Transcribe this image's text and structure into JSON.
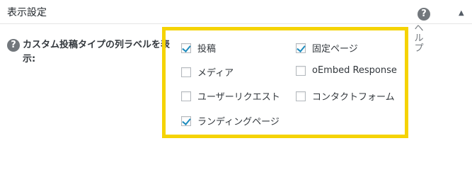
{
  "panel": {
    "title": "表示設定",
    "collapse_arrow": "▲",
    "help_tab_label": "ヘルプ",
    "help_glyph": "?"
  },
  "setting": {
    "label": "カスタム投稿タイプの列ラベルを表示:",
    "help_glyph": "?"
  },
  "options": [
    {
      "label": "投稿",
      "checked": true
    },
    {
      "label": "固定ページ",
      "checked": true
    },
    {
      "label": "メディア",
      "checked": false
    },
    {
      "label": "oEmbed Response",
      "checked": false
    },
    {
      "label": "ユーザーリクエスト",
      "checked": false
    },
    {
      "label": "コンタクトフォーム",
      "checked": false
    },
    {
      "label": "ランディングページ",
      "checked": true
    }
  ],
  "colors": {
    "highlight": "#f5d304",
    "checkmark": "#1e8cbe",
    "help_icon": "#72777c"
  }
}
